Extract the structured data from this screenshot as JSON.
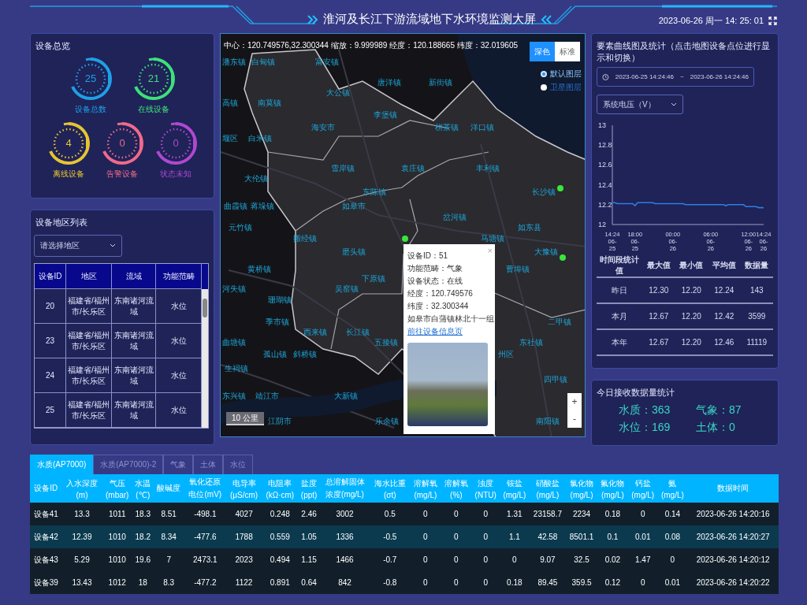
{
  "header": {
    "title": "淮河及长江下游流域地下水环境监测大屏",
    "datetime": "2023-06-26 周一 14: 25: 01"
  },
  "overview": {
    "title": "设备总览",
    "gauges": [
      {
        "value": "25",
        "label": "设备总数",
        "color": "#1ea0e6"
      },
      {
        "value": "21",
        "label": "在线设备",
        "color": "#3ee07a"
      },
      {
        "value": "4",
        "label": "离线设备",
        "color": "#e6c531"
      },
      {
        "value": "0",
        "label": "告警设备",
        "color": "#f06a8a"
      },
      {
        "value": "0",
        "label": "状态未知",
        "color": "#b048d0"
      }
    ]
  },
  "region_list": {
    "title": "设备地区列表",
    "select": {
      "placeholder": "请选择地区"
    },
    "columns": [
      "设备ID",
      "地区",
      "流域",
      "功能范畴"
    ],
    "rows": [
      [
        "20",
        "福建省/福州市/长乐区",
        "东南诸河流域",
        "水位"
      ],
      [
        "23",
        "福建省/福州市/长乐区",
        "东南诸河流域",
        "水位"
      ],
      [
        "24",
        "福建省/福州市/长乐区",
        "东南诸河流域",
        "水位"
      ],
      [
        "25",
        "福建省/福州市/长乐区",
        "东南诸河流域",
        "水位"
      ]
    ]
  },
  "map": {
    "info": "中心：120.749576,32.300344 缩放：9.999989 经度：120.188665 纬度：32.019605",
    "styles": [
      {
        "label": "深色",
        "selected": true
      },
      {
        "label": "标准",
        "selected": false
      }
    ],
    "layers": [
      {
        "label": "默认图层",
        "selected": true
      },
      {
        "label": "卫星图层",
        "selected": false
      }
    ],
    "labels": [
      "潘东镇",
      "白甸镇",
      "富安镇",
      "唐洋镇",
      "新街镇",
      "大公镇",
      "高镇",
      "南莫镇",
      "李堡镇",
      "海安市",
      "栟茶镇",
      "洋口镇",
      "堰区",
      "白米镇",
      "雪岸镇",
      "袁庄镇",
      "丰利镇",
      "大伦镇",
      "东陈镇",
      "长沙镇",
      "曲霞镇",
      "蒋垛镇",
      "如皋市",
      "岔河镇",
      "元竹镇",
      "如东县",
      "搬经镇",
      "马塘镇",
      "磨头镇",
      "大豫镇",
      "黄桥镇",
      "曹埠镇",
      "下原镇",
      "河失镇",
      "吴窑镇",
      "珊瑚镇",
      "季市镇",
      "二甲镇",
      "西来镇",
      "长江镇",
      "曲塘镇",
      "五接镇",
      "东社镇",
      "孤山镇",
      "斜桥镇",
      "州区",
      "生祠镇",
      "四甲镇",
      "东兴镇",
      "靖江市",
      "大新镇",
      "江阴市",
      "乐余镇",
      "南阳镇"
    ],
    "scale": "10 公里",
    "zoom_buttons": [
      "+",
      "-"
    ],
    "popup": {
      "close": "×",
      "lines": [
        "设备ID：51",
        "功能范畴：气象",
        "设备状态：在线",
        "经度：120.749576",
        "纬度：32.300344",
        "如皋市白蒲镇林北十一组"
      ],
      "link": "前往设备信息页"
    }
  },
  "trend": {
    "title": "要素曲线图及统计（点击地图设备点位进行显示和切换）",
    "date_range": {
      "start": "2023-06-25 14:24:46",
      "separator": "~",
      "end": "2023-06-26 14:24:46"
    },
    "select": {
      "value": "系统电压（V）"
    },
    "chart_data": {
      "type": "line",
      "categories": [
        "14:24 06-25",
        null,
        null,
        null,
        null,
        null,
        null,
        null,
        null,
        "18:00 06-25",
        null,
        null,
        null,
        null,
        null,
        null,
        null,
        null,
        null,
        null,
        null,
        null,
        null,
        null,
        "00:00 06-26",
        null,
        null,
        null,
        null,
        null,
        null,
        null,
        null,
        null,
        null,
        null,
        null,
        null,
        null,
        "06:00 06-26",
        null,
        null,
        null,
        null,
        null,
        null,
        null,
        null,
        null,
        null,
        null,
        null,
        null,
        null,
        "12:00 06-26",
        null,
        null,
        null,
        null,
        null,
        "14:24 06-26"
      ],
      "series": [
        {
          "color": "#2f7de0",
          "values": [
            12.22,
            12.22,
            12.21,
            12.21,
            12.21,
            12.21,
            12.21,
            12.21,
            12.21,
            12.19,
            12.22,
            12.22,
            12.22,
            12.22,
            12.22,
            12.22,
            12.22,
            12.21,
            12.21,
            12.21,
            12.21,
            12.21,
            12.21,
            12.21,
            12.21,
            12.21,
            12.21,
            12.21,
            12.21,
            12.2,
            12.2,
            12.2,
            12.2,
            12.2,
            12.2,
            12.2,
            12.2,
            12.2,
            12.2,
            12.2,
            12.2,
            12.2,
            12.2,
            12.2,
            12.2,
            12.19,
            12.2,
            12.2,
            12.2,
            12.2,
            12.2,
            12.2,
            12.2,
            12.18,
            12.18,
            12.18,
            12.18,
            12.18,
            12.17,
            12.17,
            12.17
          ]
        }
      ],
      "ylim": [
        12,
        13
      ],
      "yticks": [
        {
          "value": 12,
          "label": "12"
        },
        {
          "value": 12.2,
          "label": "12.2"
        },
        {
          "value": 12.4,
          "label": "12.4"
        },
        {
          "value": 12.6,
          "label": "12.6"
        },
        {
          "value": 12.8,
          "label": "12.8"
        },
        {
          "value": 13,
          "label": "13"
        }
      ]
    },
    "stats": {
      "columns": [
        "时间段统计值",
        "最大值",
        "最小值",
        "平均值",
        "数据量"
      ],
      "rows": [
        [
          "昨日",
          "12.30",
          "12.20",
          "12.24",
          "143"
        ],
        [
          "本月",
          "12.67",
          "12.20",
          "12.42",
          "3599"
        ],
        [
          "本年",
          "12.67",
          "12.20",
          "12.46",
          "11119"
        ]
      ]
    }
  },
  "today": {
    "title": "今日接收数据量统计",
    "items": [
      "水质：363",
      "气象：87",
      "水位：169",
      "土体：0"
    ]
  },
  "data_table": {
    "tabs": [
      {
        "label": "水质(AP7000)",
        "selected": true
      },
      {
        "label": "水质(AP7000)-2",
        "selected": false
      },
      {
        "label": "气象",
        "selected": false
      },
      {
        "label": "土体",
        "selected": false
      },
      {
        "label": "水位",
        "selected": false
      }
    ],
    "columns": [
      {
        "name": "设备ID"
      },
      {
        "name": "入水深度",
        "unit": "(m)"
      },
      {
        "name": "气压",
        "unit": "(mbar)"
      },
      {
        "name": "水温",
        "unit": "(℃)"
      },
      {
        "name": "酸碱度"
      },
      {
        "name": "氧化还原",
        "unit": "电位(mV)"
      },
      {
        "name": "电导率",
        "unit": "(μS/cm)"
      },
      {
        "name": "电阻率",
        "unit": "(kΩ·cm)"
      },
      {
        "name": "盐度",
        "unit": "(ppt)"
      },
      {
        "name": "总溶解固体",
        "unit": "浓度(mg/L)"
      },
      {
        "name": "海水比重",
        "unit": "(σt)"
      },
      {
        "name": "溶解氧",
        "unit": "(mg/L)"
      },
      {
        "name": "溶解氧",
        "unit": "(%)"
      },
      {
        "name": "浊度",
        "unit": "(NTU)"
      },
      {
        "name": "铵盐",
        "unit": "(mg/L)"
      },
      {
        "name": "硝酸盐",
        "unit": "(mg/L)"
      },
      {
        "name": "氯化物",
        "unit": "(mg/L)"
      },
      {
        "name": "氟化物",
        "unit": "(mg/L)"
      },
      {
        "name": "钙盐",
        "unit": "(mg/L)"
      },
      {
        "name": "氨",
        "unit": "(mg/L)"
      },
      {
        "name": "数据时间"
      }
    ],
    "rows": [
      [
        "设备41",
        "13.3",
        "1011",
        "18.3",
        "8.51",
        "-498.1",
        "4027",
        "0.248",
        "2.46",
        "3002",
        "0.5",
        "0",
        "0",
        "0",
        "1.31",
        "23158.7",
        "2234",
        "0.18",
        "0",
        "0.14",
        "2023-06-26 14:20:16"
      ],
      [
        "设备42",
        "12.39",
        "1010",
        "18.2",
        "8.34",
        "-477.6",
        "1788",
        "0.559",
        "1.05",
        "1336",
        "-0.5",
        "0",
        "0",
        "0",
        "1.1",
        "42.58",
        "8501.1",
        "0.1",
        "0.01",
        "0.08",
        "2023-06-26 14:20:27"
      ],
      [
        "设备43",
        "5.29",
        "1010",
        "19.6",
        "7",
        "2473.1",
        "2023",
        "0.494",
        "1.15",
        "1466",
        "-0.7",
        "0",
        "0",
        "0",
        "0",
        "9.07",
        "32.5",
        "0.02",
        "1.47",
        "0",
        "2023-06-26 14:20:12"
      ],
      [
        "设备39",
        "13.43",
        "1012",
        "18",
        "8.3",
        "-477.2",
        "1122",
        "0.891",
        "0.64",
        "842",
        "-0.8",
        "0",
        "0",
        "0",
        "0.18",
        "89.45",
        "359.5",
        "0.12",
        "0",
        "0.01",
        "2023-06-26 14:20:22"
      ]
    ]
  }
}
